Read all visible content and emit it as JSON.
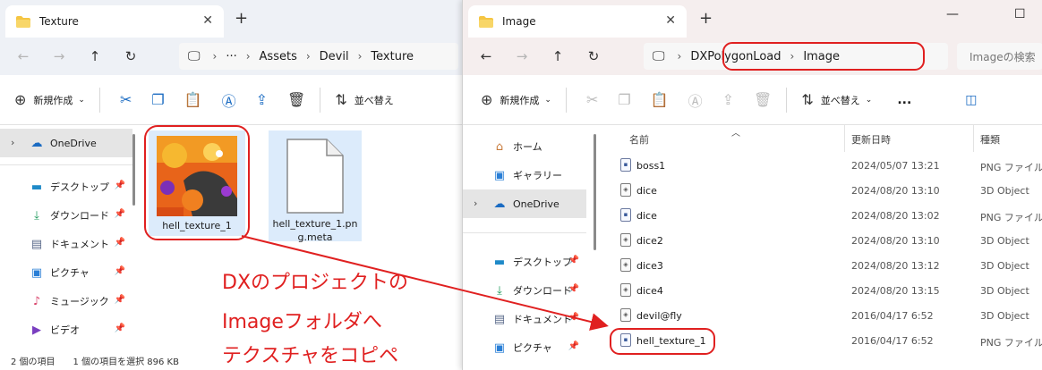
{
  "left": {
    "tab_title": "Texture",
    "breadcrumbs": [
      "Assets",
      "Devil",
      "Texture"
    ],
    "toolbar": {
      "new_label": "新規作成",
      "sort_label": "並べ替え"
    },
    "sidebar": [
      {
        "label": "OneDrive",
        "icon": "cloud-icon"
      },
      {
        "label": "デスクトップ",
        "icon": "desktop-icon"
      },
      {
        "label": "ダウンロード",
        "icon": "download-icon"
      },
      {
        "label": "ドキュメント",
        "icon": "document-icon"
      },
      {
        "label": "ピクチャ",
        "icon": "picture-icon"
      },
      {
        "label": "ミュージック",
        "icon": "music-icon"
      },
      {
        "label": "ビデオ",
        "icon": "video-icon"
      }
    ],
    "files": [
      {
        "name": "hell_texture_1"
      },
      {
        "name": "hell_texture_1.png.meta"
      }
    ],
    "status": {
      "count": "2 個の項目",
      "selected": "1 個の項目を選択 896 KB"
    }
  },
  "right": {
    "tab_title": "Image",
    "breadcrumbs": [
      "DXPolygonLoad",
      "Image"
    ],
    "search_placeholder": "Imageの検索",
    "toolbar": {
      "new_label": "新規作成",
      "sort_label": "並べ替え",
      "more": "..."
    },
    "sidebar": [
      {
        "label": "ホーム",
        "icon": "home-icon"
      },
      {
        "label": "ギャラリー",
        "icon": "gallery-icon"
      },
      {
        "label": "OneDrive",
        "icon": "cloud-icon"
      },
      {
        "label": "デスクトップ",
        "icon": "desktop-icon"
      },
      {
        "label": "ダウンロード",
        "icon": "download-icon"
      },
      {
        "label": "ドキュメント",
        "icon": "document-icon"
      },
      {
        "label": "ピクチャ",
        "icon": "picture-icon"
      }
    ],
    "columns": {
      "name": "名前",
      "date": "更新日時",
      "type": "種類"
    },
    "rows": [
      {
        "name": "boss1",
        "date": "2024/05/07 13:21",
        "type": "PNG ファイル",
        "kind": "png"
      },
      {
        "name": "dice",
        "date": "2024/08/20 13:10",
        "type": "3D Object",
        "kind": "obj"
      },
      {
        "name": "dice",
        "date": "2024/08/20 13:02",
        "type": "PNG ファイル",
        "kind": "png"
      },
      {
        "name": "dice2",
        "date": "2024/08/20 13:10",
        "type": "3D Object",
        "kind": "obj"
      },
      {
        "name": "dice3",
        "date": "2024/08/20 13:12",
        "type": "3D Object",
        "kind": "obj"
      },
      {
        "name": "dice4",
        "date": "2024/08/20 13:15",
        "type": "3D Object",
        "kind": "obj"
      },
      {
        "name": "devil@fly",
        "date": "2016/04/17 6:52",
        "type": "3D Object",
        "kind": "obj"
      },
      {
        "name": "hell_texture_1",
        "date": "2016/04/17 6:52",
        "type": "PNG ファイル",
        "kind": "png"
      }
    ]
  },
  "annotation": [
    "DXのプロジェクトの",
    "Imageフォルダへ",
    "テクスチャをコピペ"
  ],
  "colors": {
    "accent_red": "#e02020",
    "folder_yellow": "#f5c542",
    "selection": "#dcebfb"
  }
}
